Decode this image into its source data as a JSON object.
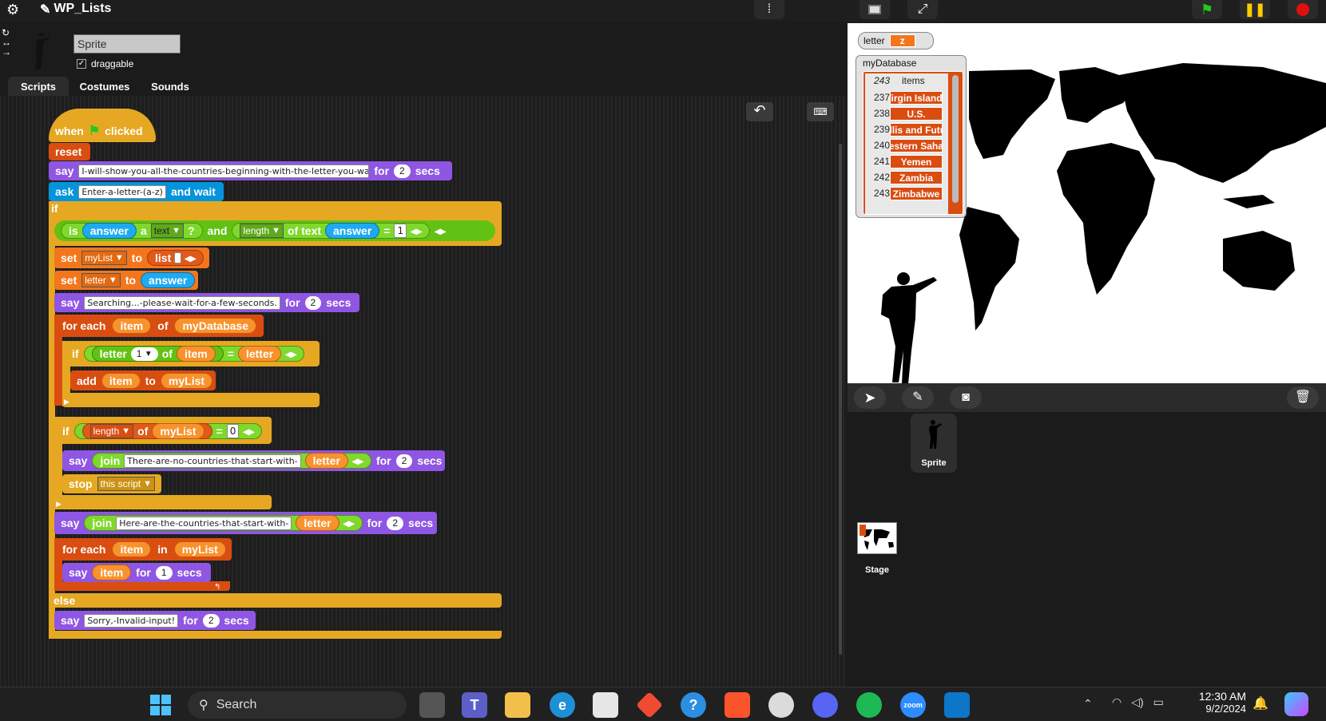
{
  "app": {
    "title": "WP_Lists"
  },
  "sprite": {
    "name": "Sprite",
    "draggable_label": "draggable"
  },
  "tabs": [
    "Scripts",
    "Costumes",
    "Sounds"
  ],
  "script": {
    "hat": {
      "when": "when",
      "clicked": "clicked"
    },
    "reset": "reset",
    "say1": {
      "say": "say",
      "text": "I-will-show-you-all-the-countries-beginning-with-the-letter-you-want",
      "for": "for",
      "n": "2",
      "secs": "secs"
    },
    "ask": {
      "ask": "ask",
      "text": "Enter-a-letter-(a-z)",
      "wait": "and wait"
    },
    "if1": {
      "if": "if",
      "is": "is",
      "answer": "answer",
      "a": "a",
      "type": "text",
      "q": "?",
      "and": "and",
      "length": "length",
      "oftext": "of text",
      "eq": "=",
      "one": "1"
    },
    "set1": {
      "set": "set",
      "var": "myList",
      "to": "to",
      "list": "list"
    },
    "set2": {
      "set": "set",
      "var": "letter",
      "to": "to",
      "answer": "answer"
    },
    "say2": {
      "say": "say",
      "text": "Searching...-please-wait-for-a-few-seconds.",
      "for": "for",
      "n": "2",
      "secs": "secs"
    },
    "foreach1": {
      "label": "for each",
      "item": "item",
      "of": "of",
      "list": "myDatabase"
    },
    "if2": {
      "if": "if",
      "letter": "letter",
      "n": "1",
      "of": "of",
      "item": "item",
      "eq": "=",
      "letterv": "letter"
    },
    "add": {
      "add": "add",
      "item": "item",
      "to": "to",
      "list": "myList"
    },
    "if3": {
      "if": "if",
      "length": "length",
      "of": "of",
      "list": "myList",
      "eq": "=",
      "zero": "0"
    },
    "say3": {
      "say": "say",
      "join": "join",
      "text": "There-are-no-countries-that-start-with-",
      "letter": "letter",
      "for": "for",
      "n": "2",
      "secs": "secs"
    },
    "stop": {
      "stop": "stop",
      "opt": "this script"
    },
    "say4": {
      "say": "say",
      "join": "join",
      "text": "Here-are-the-countries-that-start-with-",
      "letter": "letter",
      "for": "for",
      "n": "2",
      "secs": "secs"
    },
    "foreach2": {
      "label": "for each",
      "item": "item",
      "in": "in",
      "list": "myList"
    },
    "say5": {
      "say": "say",
      "item": "item",
      "for": "for",
      "n": "1",
      "secs": "secs"
    },
    "else": "else",
    "say6": {
      "say": "say",
      "text": "Sorry,-Invalid-input!",
      "for": "for",
      "n": "2",
      "secs": "secs"
    }
  },
  "watchers": {
    "letter": {
      "label": "letter",
      "value": "z"
    },
    "db": {
      "label": "myDatabase",
      "count": "243",
      "items_label": "items",
      "rows": [
        {
          "i": "237",
          "v": "Virgin Islands"
        },
        {
          "i": "238",
          "v": "U.S."
        },
        {
          "i": "239",
          "v": "Wallis and Futuna"
        },
        {
          "i": "240",
          "v": "Western Sahara"
        },
        {
          "i": "241",
          "v": "Yemen"
        },
        {
          "i": "242",
          "v": "Zambia"
        },
        {
          "i": "243",
          "v": "Zimbabwe"
        }
      ]
    }
  },
  "corral": {
    "sprite": "Sprite",
    "stage": "Stage"
  },
  "taskbar": {
    "search": "Search",
    "time": "12:30 AM",
    "date": "9/2/2024"
  },
  "colors": {
    "looks": "#8f56e3",
    "control": "#e6a822",
    "variables": "#f3761d",
    "lists": "#d94d11",
    "operators": "#62c213",
    "sensing": "#0494dc"
  }
}
